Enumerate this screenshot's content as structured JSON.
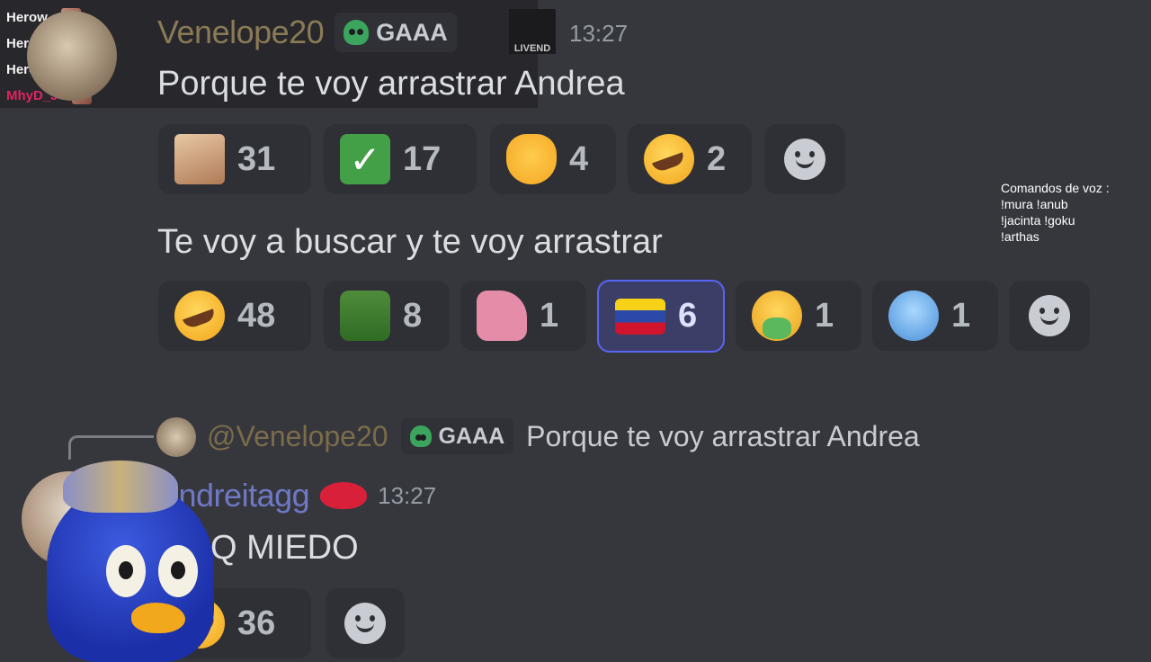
{
  "stream_chat": [
    {
      "user": "Herow :",
      "color": "#f2f2f2"
    },
    {
      "user": "Herow :",
      "color": "#f2f2f2"
    },
    {
      "user": "Herow :",
      "color": "#f2f2f2"
    },
    {
      "user": "MhyD_J :",
      "color": "#e0245e"
    }
  ],
  "message1": {
    "username": "Venelope20",
    "tag": "GAAA",
    "badge_text": "LIVEND",
    "time": "13:27",
    "text": "Porque te voy arrastrar Andrea",
    "reactions": [
      {
        "emoji": "cat",
        "count": "31"
      },
      {
        "emoji": "check",
        "count": "17"
      },
      {
        "emoji": "clap",
        "count": "4"
      },
      {
        "emoji": "rofl",
        "count": "2"
      }
    ]
  },
  "message2": {
    "text": "Te voy a buscar y te voy arrastrar",
    "reactions": [
      {
        "emoji": "rofl",
        "count": "48"
      },
      {
        "emoji": "frog",
        "count": "8"
      },
      {
        "emoji": "pig",
        "count": "1"
      },
      {
        "emoji": "venezuela-flag",
        "count": "6",
        "selected": true
      },
      {
        "emoji": "vomit",
        "count": "1"
      },
      {
        "emoji": "cold-face",
        "count": "1"
      }
    ]
  },
  "reply": {
    "username": "@Venelope20",
    "tag": "GAAA",
    "text": "Porque te voy arrastrar Andrea"
  },
  "message3": {
    "username": "Andreitagg",
    "time": "13:27",
    "text": "Q MIEDO",
    "reactions": [
      {
        "emoji": "rofl",
        "count": "36"
      }
    ]
  },
  "voice_commands": "Comandos de voz :\n!mura !anub\n!jacinta !goku\n!arthas",
  "colors": {
    "background": "#36373d",
    "reaction_bg": "#2f3035",
    "selected_border": "#5865f2"
  }
}
